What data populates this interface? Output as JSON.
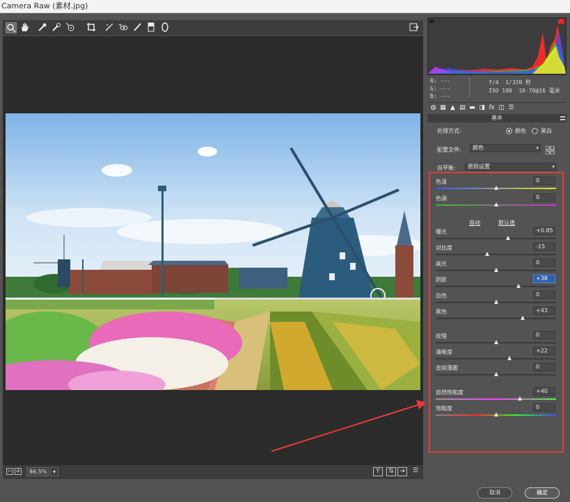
{
  "window": {
    "title": "Camera Raw (素材.jpg)"
  },
  "toolbar": {
    "tools": [
      "zoom-tool",
      "hand-tool",
      "white-balance-tool",
      "color-sampler-tool",
      "targeted-adjustment-tool",
      "crop-tool",
      "straighten-tool",
      "spot-removal-tool",
      "red-eye-removal-tool",
      "adjustment-brush",
      "graduated-filter",
      "radial-filter"
    ],
    "open_prefs": "export-icon"
  },
  "readout": {
    "r_label": "R:",
    "g_label": "G:",
    "b_label": "B:",
    "r_val": "---",
    "g_val": "---",
    "b_val": "---",
    "aperture": "f/4",
    "shutter": "1/320 秒",
    "iso": "ISO 100",
    "lens": "16-70@16 毫米"
  },
  "panel": {
    "section_title": "基本",
    "process_label": "处理方式:",
    "process_color": "颜色",
    "process_bw": "黑白",
    "profile_label": "配置文件:",
    "profile_value": "颜色",
    "wb_label": "白平衡:",
    "wb_value": "原照设置",
    "auto_link": "自动",
    "default_link": "默认值"
  },
  "sliders": [
    {
      "label": "色温",
      "value": "0",
      "pos": 0.5
    },
    {
      "label": "色调",
      "value": "0",
      "pos": 0.5
    },
    {
      "label": "曝光",
      "value": "+0.85",
      "pos": 0.6
    },
    {
      "label": "对比度",
      "value": "-15",
      "pos": 0.43
    },
    {
      "label": "高光",
      "value": "0",
      "pos": 0.5
    },
    {
      "label": "阴影",
      "value": "+38",
      "pos": 0.69
    },
    {
      "label": "白色",
      "value": "0",
      "pos": 0.5
    },
    {
      "label": "黑色",
      "value": "+43",
      "pos": 0.72
    },
    {
      "label": "纹理",
      "value": "0",
      "pos": 0.5
    },
    {
      "label": "清晰度",
      "value": "+22",
      "pos": 0.61
    },
    {
      "label": "去除薄雾",
      "value": "0",
      "pos": 0.5
    },
    {
      "label": "自然饱和度",
      "value": "+40",
      "pos": 0.7
    },
    {
      "label": "饱和度",
      "value": "0",
      "pos": 0.5
    }
  ],
  "zoom": {
    "value": "86.5%"
  },
  "buttons": {
    "cancel": "取消",
    "ok": "确定"
  },
  "colors": {
    "annotation": "#e83b3b",
    "focus": "#4a8cff"
  }
}
